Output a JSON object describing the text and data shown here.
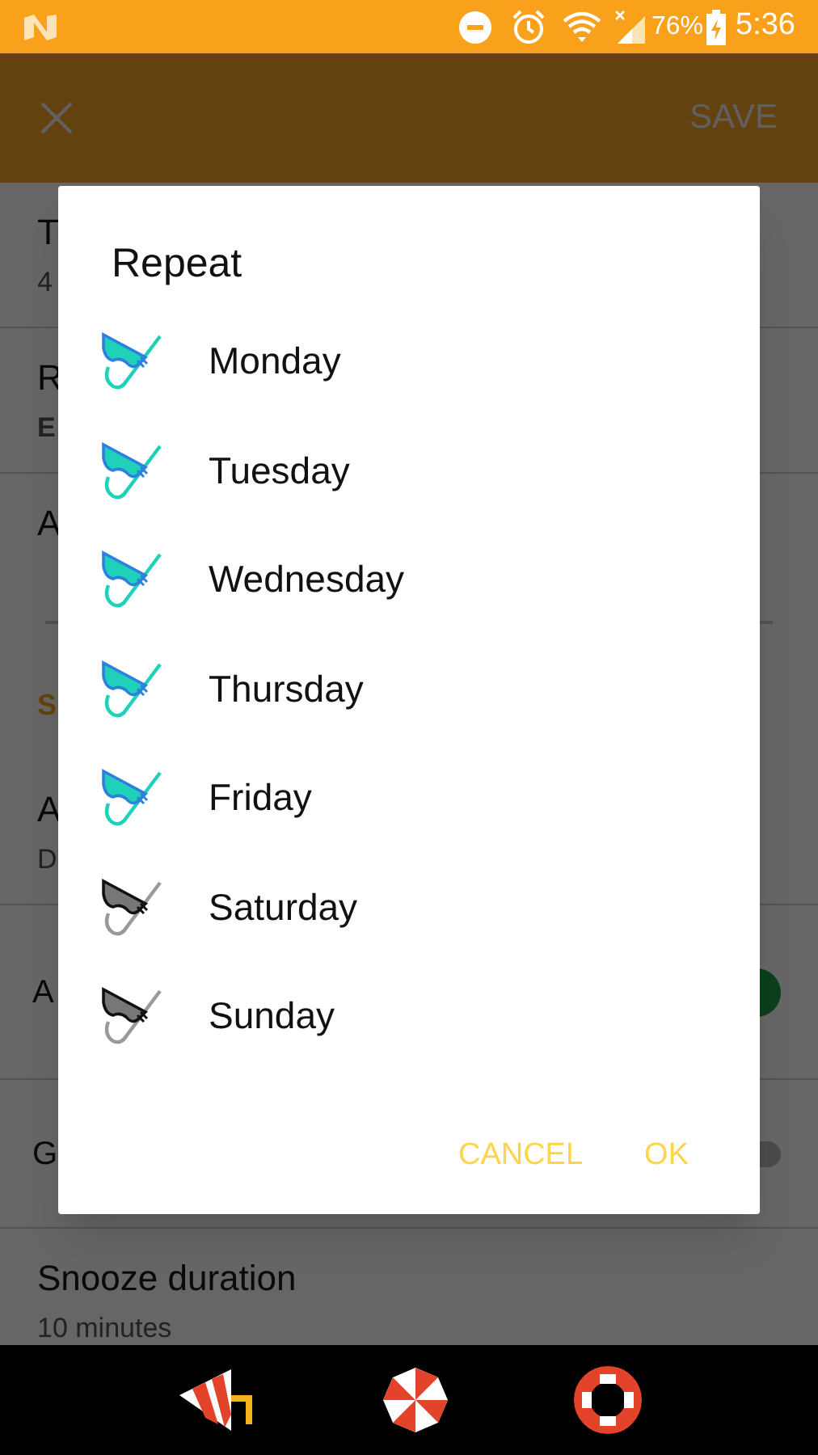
{
  "status_bar": {
    "battery": "76%",
    "time": "5:36"
  },
  "app_bar": {
    "action": "SAVE"
  },
  "settings": [
    {
      "kind": "row",
      "title": "T",
      "subtitle": "4",
      "bold_subtitle": false
    },
    {
      "kind": "row",
      "title": "R",
      "subtitle": "E",
      "bold_subtitle": true
    },
    {
      "kind": "field",
      "title": "A"
    },
    {
      "kind": "header",
      "title": "S"
    },
    {
      "kind": "row",
      "title": "A",
      "subtitle": "D",
      "bold_subtitle": false
    },
    {
      "kind": "switch",
      "title": "A",
      "on": true
    },
    {
      "kind": "switch",
      "title": "G",
      "on": false
    },
    {
      "kind": "row",
      "title": "Snooze duration",
      "subtitle": "10 minutes",
      "bold_subtitle": false
    }
  ],
  "dialog": {
    "title": "Repeat",
    "days": [
      {
        "label": "Monday",
        "checked": true
      },
      {
        "label": "Tuesday",
        "checked": true
      },
      {
        "label": "Wednesday",
        "checked": true
      },
      {
        "label": "Thursday",
        "checked": true
      },
      {
        "label": "Friday",
        "checked": true
      },
      {
        "label": "Saturday",
        "checked": false
      },
      {
        "label": "Sunday",
        "checked": false
      }
    ],
    "buttons": [
      "CANCEL",
      "OK"
    ]
  }
}
